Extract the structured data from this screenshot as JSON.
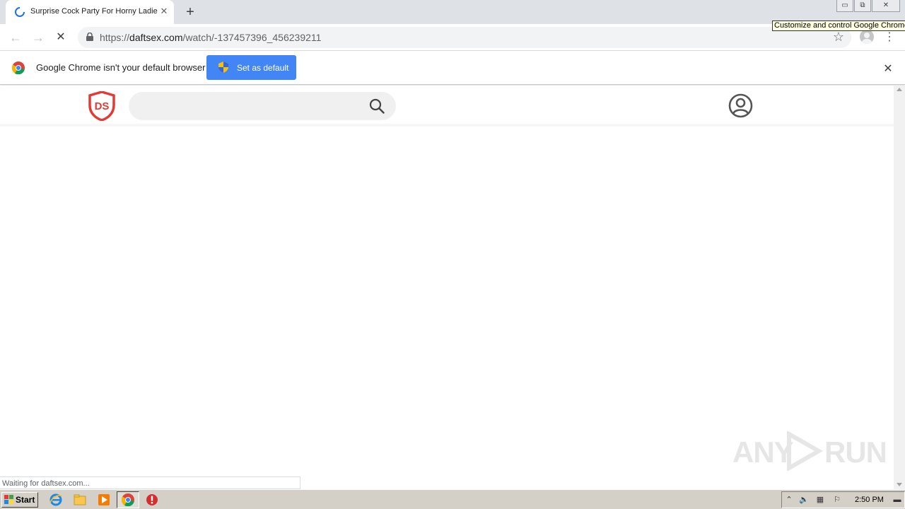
{
  "tab": {
    "title": "Surprise Cock Party For Horny Ladie",
    "close": "✕",
    "new_tab": "+"
  },
  "tooltip": "Customize and control Google Chrome",
  "window_controls": {
    "minimize": "▭",
    "restore": "⧉",
    "close": "✕"
  },
  "toolbar": {
    "back": "←",
    "forward": "→",
    "stop": "✕",
    "url_scheme": "https://",
    "url_host": "daftsex.com",
    "url_path": "/watch/-137457396_456239211",
    "bookmark": "☆",
    "menu": "⋮"
  },
  "infobar": {
    "message": "Google Chrome isn't your default browser",
    "button": "Set as default",
    "close": "✕"
  },
  "site": {
    "logo_text": "DS"
  },
  "status": "Waiting for daftsex.com...",
  "watermark": {
    "left": "ANY",
    "right": "RUN"
  },
  "taskbar": {
    "start": "Start",
    "clock": "2:50 PM"
  },
  "colors": {
    "accent": "#4285f4",
    "logo_red": "#e53935",
    "tabstrip": "#dee1e6",
    "taskbar": "#d4d0c8"
  }
}
